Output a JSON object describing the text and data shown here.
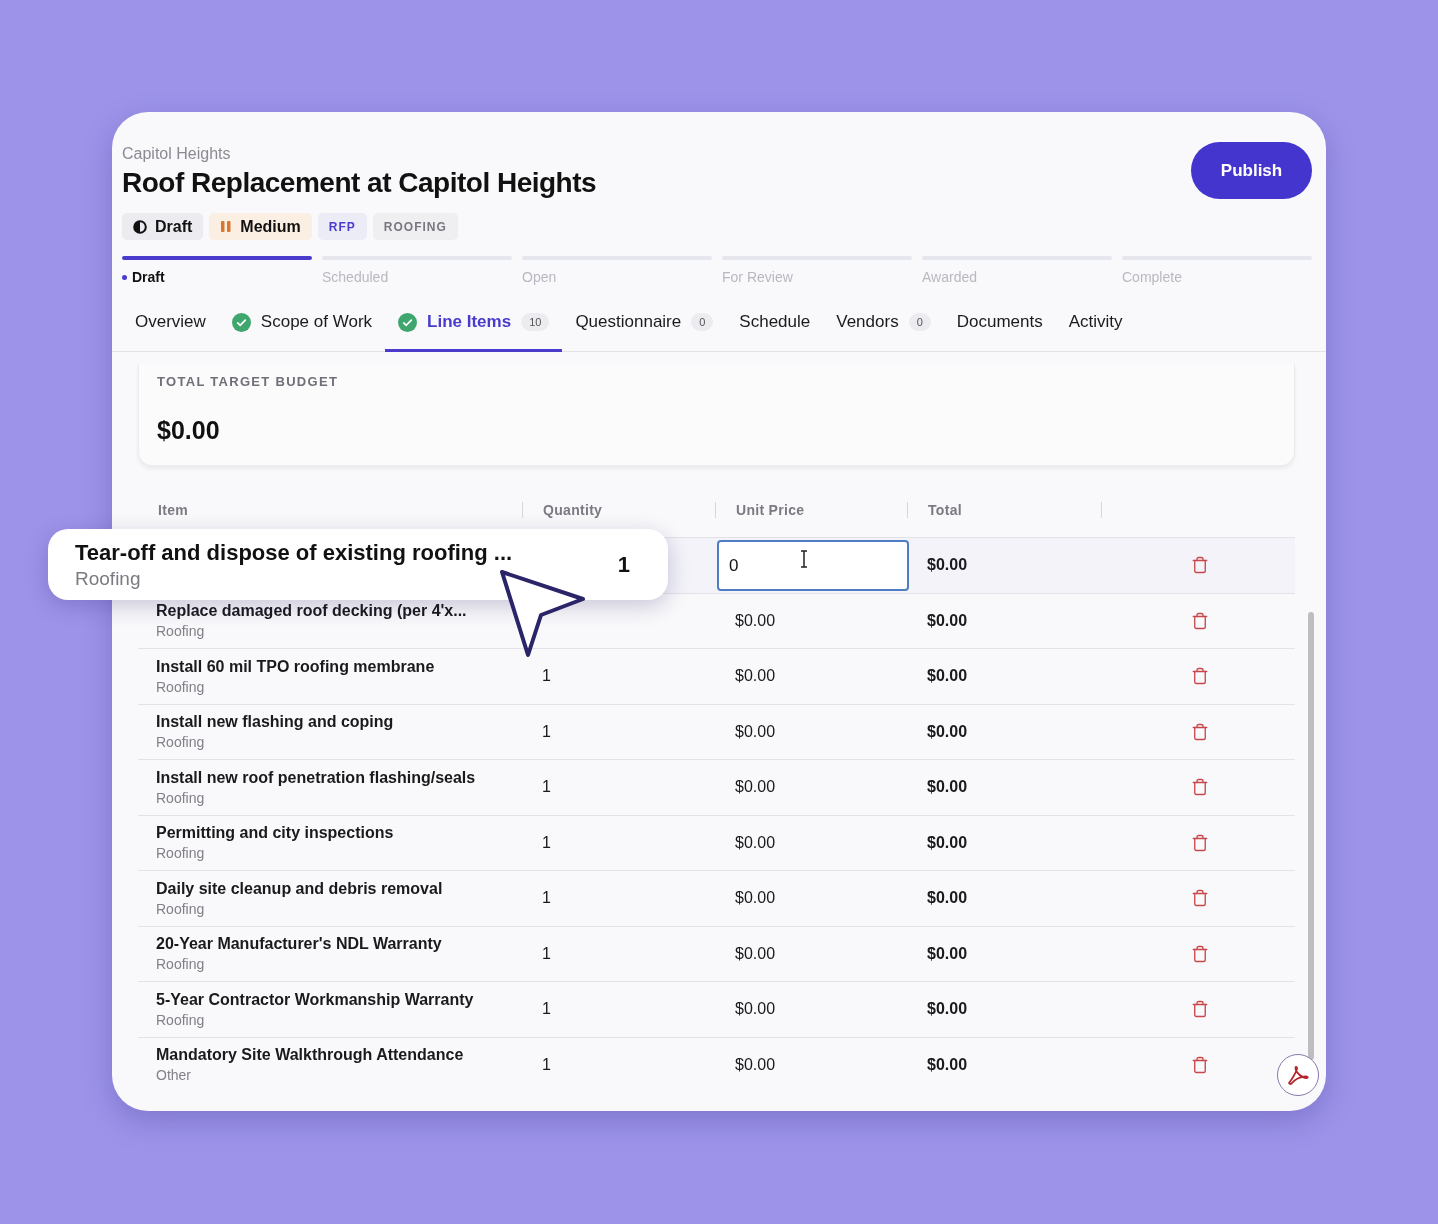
{
  "header": {
    "breadcrumb": "Capitol Heights",
    "title": "Roof Replacement at Capitol Heights",
    "publish_button": "Publish"
  },
  "badges": [
    {
      "kind": "status",
      "label": "Draft"
    },
    {
      "kind": "priority",
      "label": "Medium"
    },
    {
      "kind": "type",
      "label": "RFP"
    },
    {
      "kind": "category",
      "label": "ROOFING"
    }
  ],
  "stages": [
    {
      "label": "Draft",
      "selected": true
    },
    {
      "label": "Scheduled",
      "selected": false
    },
    {
      "label": "Open",
      "selected": false
    },
    {
      "label": "For Review",
      "selected": false
    },
    {
      "label": "Awarded",
      "selected": false
    },
    {
      "label": "Complete",
      "selected": false
    }
  ],
  "tabs": [
    {
      "label": "Overview",
      "selected": false,
      "completed": false
    },
    {
      "label": "Scope of Work",
      "selected": false,
      "completed": true
    },
    {
      "label": "Line Items",
      "selected": true,
      "completed": true,
      "count": "10"
    },
    {
      "label": "Questionnaire",
      "selected": false,
      "completed": false,
      "count": "0"
    },
    {
      "label": "Schedule",
      "selected": false,
      "completed": false
    },
    {
      "label": "Vendors",
      "selected": false,
      "completed": false,
      "count": "0"
    },
    {
      "label": "Documents",
      "selected": false,
      "completed": false
    },
    {
      "label": "Activity",
      "selected": false,
      "completed": false
    }
  ],
  "budget": {
    "label": "TOTAL TARGET BUDGET",
    "value": "$0.00"
  },
  "table": {
    "columns": [
      "Item",
      "Quantity",
      "Unit Price",
      "Total"
    ],
    "rows": [
      {
        "item": "Tear-off and dispose of existing roofing ...",
        "category": "Roofing",
        "quantity": "1",
        "unit_price": "0",
        "total": "$0.00",
        "dragging": true,
        "editing": true
      },
      {
        "item": "Replace damaged roof decking (per 4'x...",
        "category": "Roofing",
        "unit_price": "$0.00",
        "total": "$0.00",
        "dragging": false,
        "editing": false
      },
      {
        "item": "Install 60 mil TPO roofing membrane",
        "category": "Roofing",
        "quantity": "1",
        "unit_price": "$0.00",
        "total": "$0.00",
        "dragging": false,
        "editing": false
      },
      {
        "item": "Install new flashing and coping",
        "category": "Roofing",
        "quantity": "1",
        "unit_price": "$0.00",
        "total": "$0.00",
        "dragging": false,
        "editing": false
      },
      {
        "item": "Install new roof penetration flashing/seals",
        "category": "Roofing",
        "quantity": "1",
        "unit_price": "$0.00",
        "total": "$0.00",
        "dragging": false,
        "editing": false
      },
      {
        "item": "Permitting and city inspections",
        "category": "Roofing",
        "quantity": "1",
        "unit_price": "$0.00",
        "total": "$0.00",
        "dragging": false,
        "editing": false
      },
      {
        "item": "Daily site cleanup and debris removal",
        "category": "Roofing",
        "quantity": "1",
        "unit_price": "$0.00",
        "total": "$0.00",
        "dragging": false,
        "editing": false
      },
      {
        "item": "20-Year Manufacturer's NDL Warranty",
        "category": "Roofing",
        "quantity": "1",
        "unit_price": "$0.00",
        "total": "$0.00",
        "dragging": false,
        "editing": false
      },
      {
        "item": "5-Year Contractor Workmanship Warranty",
        "category": "Roofing",
        "quantity": "1",
        "unit_price": "$0.00",
        "total": "$0.00",
        "dragging": false,
        "editing": false
      },
      {
        "item": "Mandatory Site Walkthrough Attendance",
        "category": "Other",
        "quantity": "1",
        "unit_price": "$0.00",
        "total": "$0.00",
        "dragging": false,
        "editing": false
      }
    ]
  }
}
